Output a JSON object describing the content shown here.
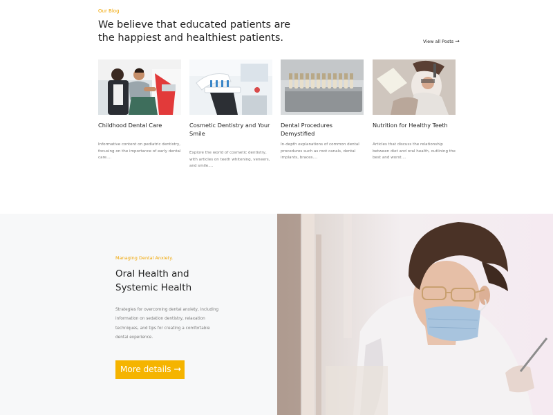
{
  "blog": {
    "eyebrow": "Our Blog",
    "heading": "We believe that educated patients are the happiest and healthiest patients.",
    "view_all_label": "View all Posts",
    "view_all_arrow": "➞",
    "posts": [
      {
        "title": "Childhood Dental Care",
        "excerpt": "Informative content on pediatric dentistry, focusing on the importance of early dental care...."
      },
      {
        "title": "Cosmetic Dentistry and Your Smile",
        "excerpt": "Explore the world of cosmetic dentistry, with articles on teeth whitening, veneers, and smile...."
      },
      {
        "title": "Dental Procedures Demystified",
        "excerpt": "In-depth explanations of common dental procedures such as root canals, dental implants, braces...."
      },
      {
        "title": "Nutrition for Healthy Teeth",
        "excerpt": "Articles that discuss the relationship between diet and oral health, outlining the best and worst...."
      }
    ]
  },
  "feature": {
    "eyebrow": "Managing Dental Anxiety.",
    "title": "Oral Health and Systemic Health",
    "text": "Strategies for overcoming dental anxiety, including information on sedation dentistry, relaxation techniques, and tips for creating a comfortable dental experience.",
    "button_label": "More details",
    "button_arrow": "➞"
  },
  "colors": {
    "accent": "#f5b400",
    "eyebrow": "#f0a500",
    "heading": "#222222",
    "body_text": "#777777",
    "feature_bg": "#f7f8f9"
  },
  "icons": {
    "view_all": "arrow-right-icon",
    "button": "arrow-right-icon"
  }
}
